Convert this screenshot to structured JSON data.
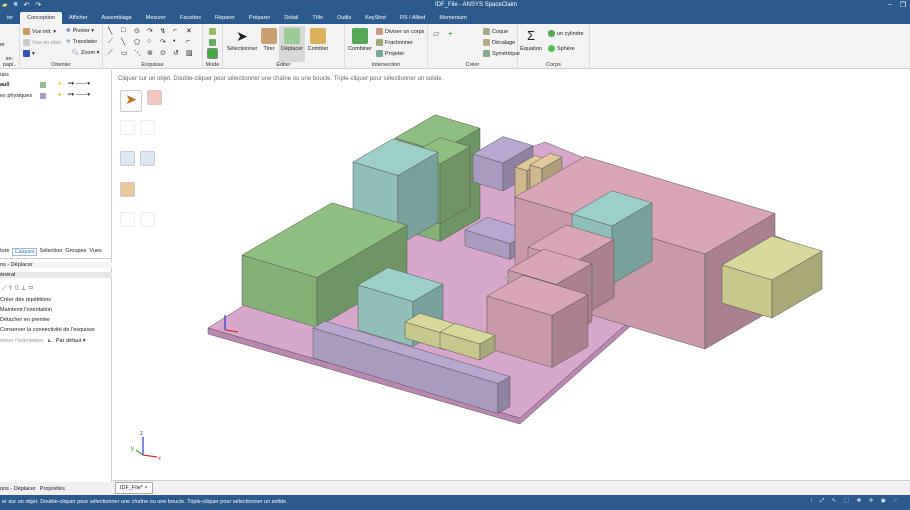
{
  "window": {
    "title": "IDF_File - ANSYS SpaceClaim",
    "minimize": "–",
    "restore": "❐"
  },
  "tabs": [
    {
      "label": "ier"
    },
    {
      "label": "Conception",
      "active": true
    },
    {
      "label": "Afficher"
    },
    {
      "label": "Assemblage"
    },
    {
      "label": "Mesurer"
    },
    {
      "label": "Facettes"
    },
    {
      "label": "Réparer"
    },
    {
      "label": "Préparer"
    },
    {
      "label": "Détail"
    },
    {
      "label": "Tôle"
    },
    {
      "label": "Outils"
    },
    {
      "label": "KeyShot"
    },
    {
      "label": "RS / Allied"
    },
    {
      "label": "Momentum"
    }
  ],
  "ribbon": {
    "clipboard": {
      "label": "se-papi..",
      "paste": "er"
    },
    "orienter": {
      "label": "Orienter",
      "vue_init": "Vue init. ▾",
      "vue_plan": "Vue en plan",
      "pivoter": "Pivoter ▾",
      "translater": "Translater",
      "zoom": "Zoom ▾"
    },
    "esquisse": {
      "label": "Esquisse"
    },
    "mode": {
      "label": "Mode"
    },
    "editer": {
      "label": "Éditer",
      "selectionner": "Sélectionner",
      "tirer": "Tirer",
      "deplacer": "Déplacer",
      "combler": "Combler"
    },
    "intersection": {
      "label": "Intersection",
      "combiner": "Combiner",
      "diviser": "Diviser un corps",
      "fractionner": "Fractionner",
      "projeter": "Projeter"
    },
    "creer": {
      "label": "Créer",
      "coque": "Coque",
      "decalage": "Décalage",
      "symetrique": "Symétrique"
    },
    "corps": {
      "label": "Corps",
      "equation": "Équation",
      "cylindre": "un cylindre",
      "sphere": "Sphère"
    }
  },
  "left_panel": {
    "header": "ues",
    "layers": [
      {
        "name": "au0",
        "color": "#8fbf8f"
      },
      {
        "name": "es physiques",
        "color": "#a89cc8"
      }
    ],
    "tabs": [
      "ture",
      "Calques",
      "Sélection",
      "Groupes",
      "Vues"
    ],
    "options_title": "ns - Déplacer",
    "section": "énéral",
    "options": [
      "Créer des répétitions",
      "Maintenir l'orientation",
      "Détacher en premier",
      "Conserver la connectivité de l'esquisse"
    ],
    "orient_label": "oriser l'orientation",
    "orient_value": "Par défaut ▾",
    "bottom_tabs": [
      "ons - Déplacer",
      "Propriétés"
    ]
  },
  "viewport": {
    "hint": "Cliquer sur un objet.  Double-cliquer pour sélectionner une chaîne ou une boucle.  Triple-cliquer pour sélectionner un solide.",
    "axis_z": "z",
    "axis_y": "y",
    "axis_x": "x"
  },
  "doc_tab": {
    "label": "IDF_File* ×"
  },
  "status": {
    "text": "er sur un objet.  Double-cliquer pour sélectionner une chaîne ou une boucle.  Triple-cliquer pour sélectionner un solide."
  },
  "colors": {
    "titlebar": "#2b5b8c",
    "board": "#d8a8cc",
    "green": "#8fbf80",
    "teal": "#9ccfc8",
    "pink": "#d9a6b8",
    "purple": "#b8a8d0",
    "tan": "#e0c89a",
    "olive": "#d8d89a"
  }
}
